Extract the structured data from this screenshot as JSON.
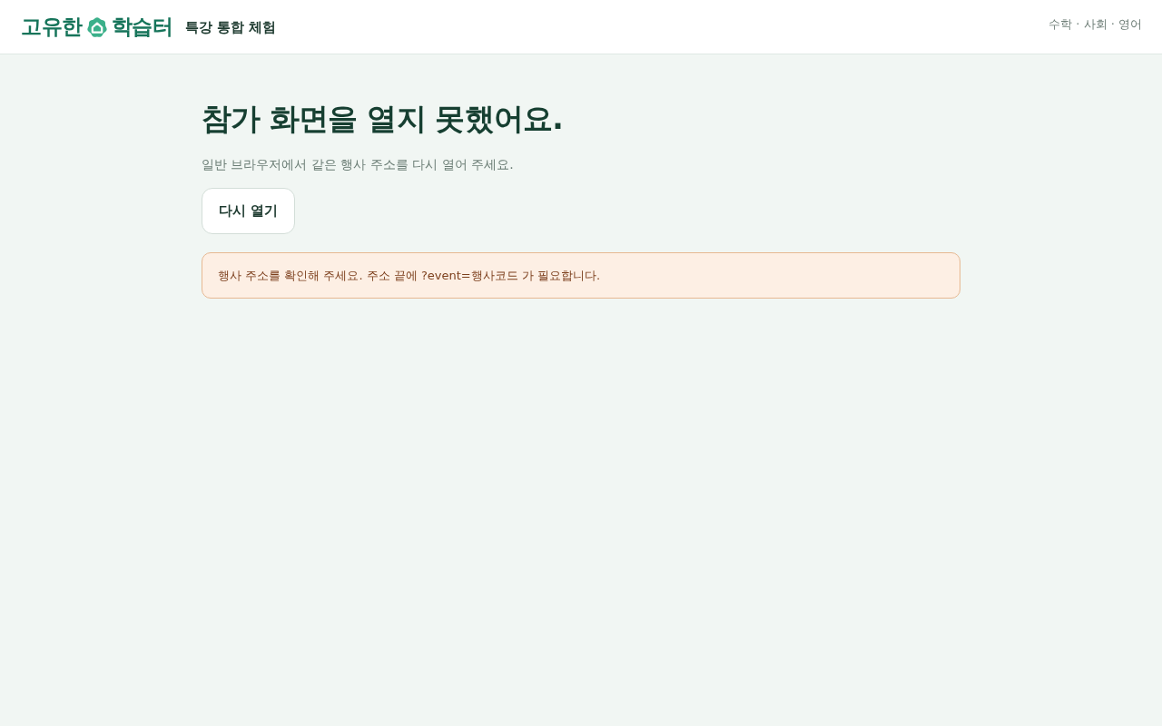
{
  "header": {
    "logo": {
      "text_start": "고유한",
      "text_end": "학습터"
    },
    "subtitle": "특강 통합 체험",
    "subjects": "수학 · 사회 · 영어"
  },
  "main": {
    "title": "참가 화면을 열지 못했어요.",
    "message": "일반 브라우저에서 같은 행사 주소를 다시 열어 주세요.",
    "button": "다시 열기",
    "alert": {
      "kind": "warning",
      "text": "행사 주소를 확인해 주세요. 주소 끝에 ?event=행사코드 가 필요합니다."
    }
  }
}
